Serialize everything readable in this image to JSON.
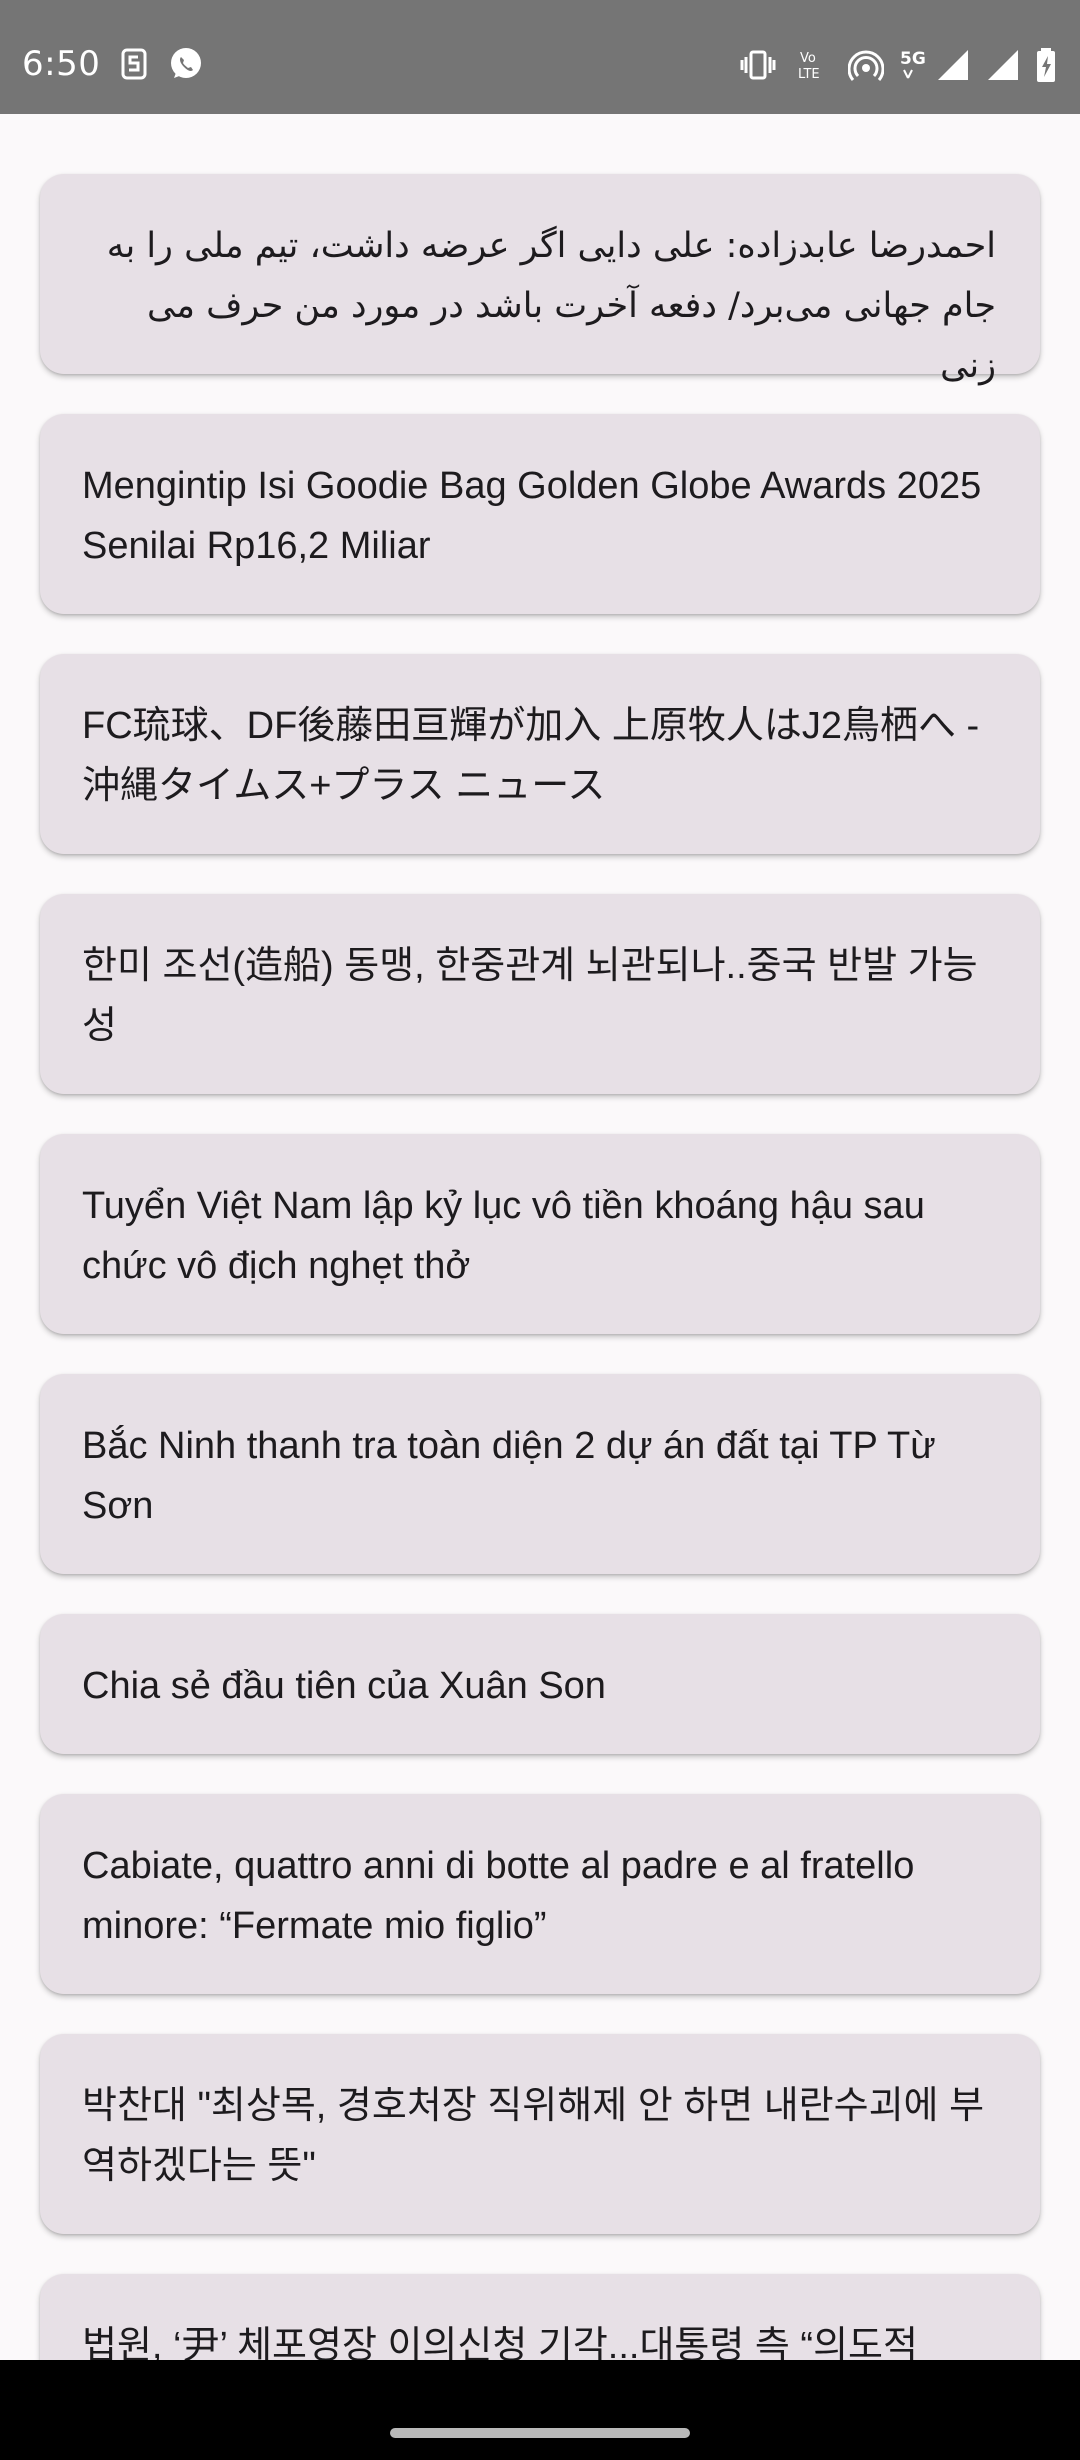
{
  "status_bar": {
    "time": "6:50",
    "left_icons": [
      "sim-s-icon",
      "whatsapp-icon"
    ],
    "right_icons": [
      "vibrate-icon",
      "volte-icon",
      "hotspot-icon",
      "5g-signal-icon",
      "signal-icon",
      "battery-charging-icon"
    ]
  },
  "news": [
    {
      "title": "احمدرضا عابدزاده: علی دایی اگر عرضه داشت، تیم ملی را به جام جهانی می‌برد/ دفعه آخرت باشد در مورد من حرف می زنی",
      "rtl": true
    },
    {
      "title": "Mengintip Isi Goodie Bag Golden Globe Awards 2025 Senilai Rp16,2 Miliar"
    },
    {
      "title": "FC琉球、DF後藤田亘輝が加入 上原牧人はJ2鳥栖へ - 沖縄タイムス+プラス ニュース"
    },
    {
      "title": "한미 조선(造船) 동맹, 한중관계 뇌관되나..중국 반발 가능성"
    },
    {
      "title": "Tuyển Việt Nam lập kỷ lục vô tiền khoáng hậu sau chức vô địch nghẹt thở"
    },
    {
      "title": "Bắc Ninh thanh tra toàn diện 2 dự án đất tại TP Từ Sơn"
    },
    {
      "title": "Chia sẻ đầu tiên của Xuân Son"
    },
    {
      "title": "Cabiate, quattro anni di botte al padre e al fratello minore: “Fermate mio figlio”"
    },
    {
      "title": "박찬대 \"최상목, 경호처장 직위해제 안 하면 내란수괴에 부역하겠다는 뜻\""
    },
    {
      "title": "법원, ‘尹’ 체포영장 이의신청 기각...대통령 측 “의도적"
    }
  ]
}
